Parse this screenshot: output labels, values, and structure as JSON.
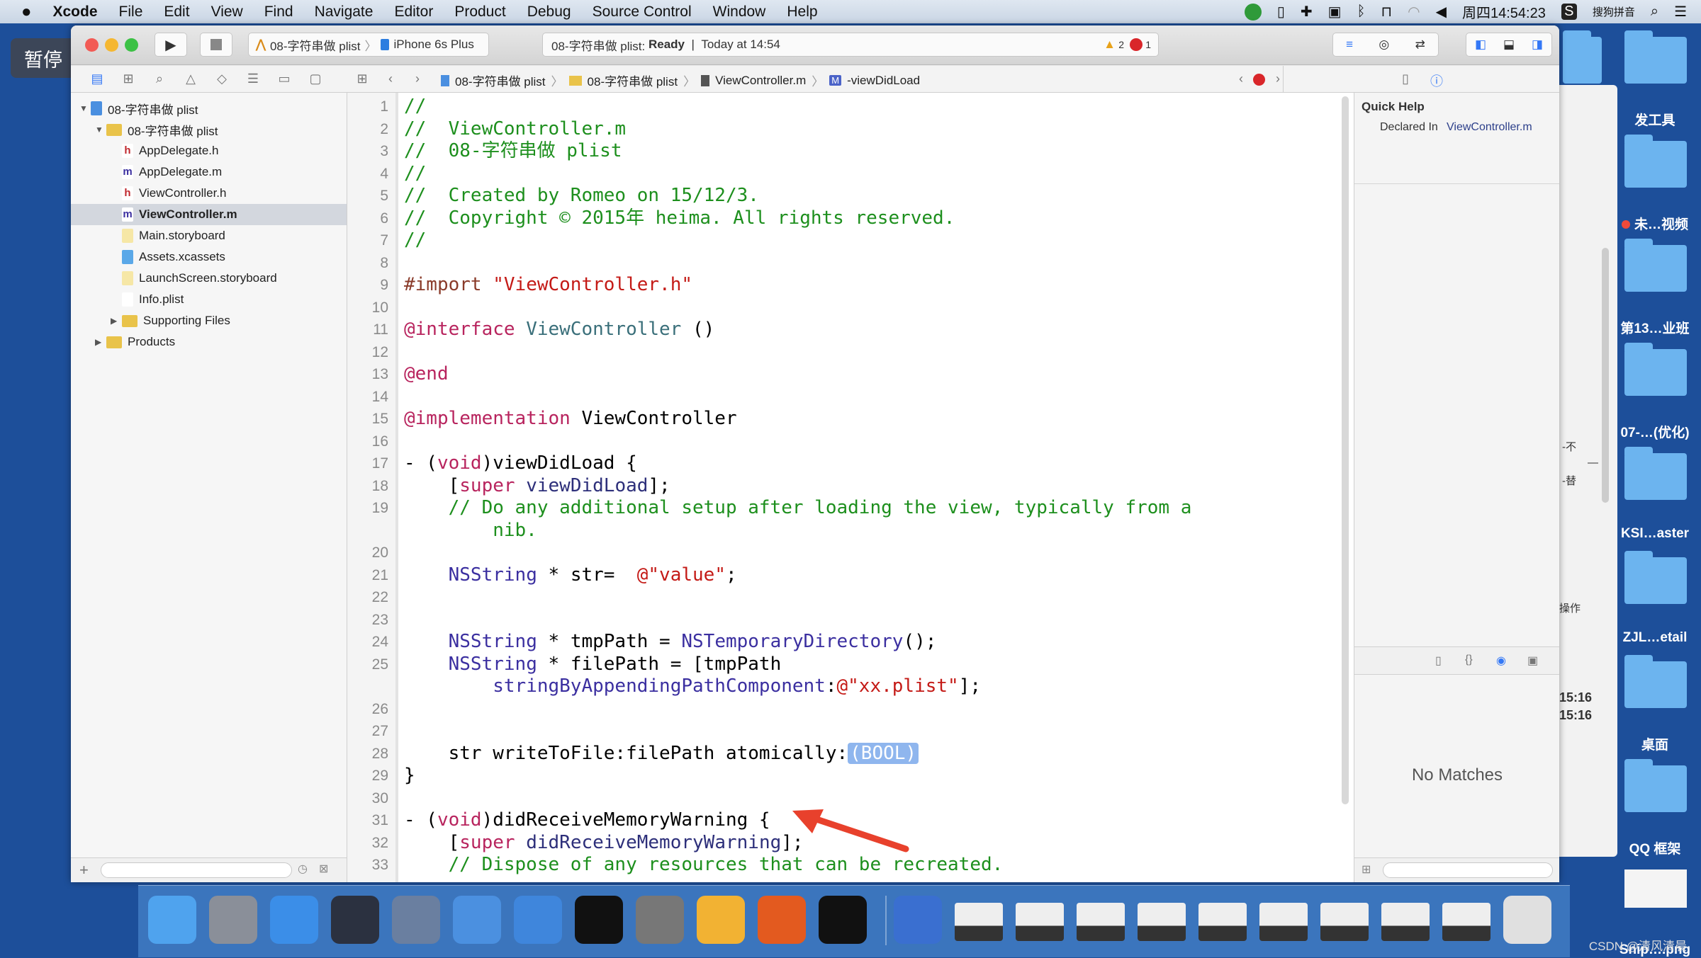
{
  "menubar": {
    "app": "Xcode",
    "items": [
      "File",
      "Edit",
      "View",
      "Find",
      "Navigate",
      "Editor",
      "Product",
      "Debug",
      "Source Control",
      "Window",
      "Help"
    ],
    "clock": "周四14:54:23",
    "ime": "搜狗拼音"
  },
  "overlay_badge": "暂停",
  "toolbar": {
    "scheme_project": "08-字符串做 plist",
    "scheme_device": "iPhone 6s Plus",
    "status_project": "08-字符串做 plist:",
    "status_state": "Ready",
    "status_sep": "|",
    "status_time": "Today at 14:54",
    "warnings": "2",
    "errors": "1"
  },
  "jumpbar": {
    "crumbs": [
      "08-字符串做 plist",
      "08-字符串做 plist",
      "ViewController.m",
      "-viewDidLoad"
    ],
    "method_badge": "M"
  },
  "navigator": {
    "items": [
      {
        "label": "08-字符串做 plist",
        "depth": 0,
        "kind": "project",
        "disclosure": "open"
      },
      {
        "label": "08-字符串做 plist",
        "depth": 1,
        "kind": "folder",
        "disclosure": "open"
      },
      {
        "label": "AppDelegate.h",
        "depth": 2,
        "kind": "h"
      },
      {
        "label": "AppDelegate.m",
        "depth": 2,
        "kind": "m"
      },
      {
        "label": "ViewController.h",
        "depth": 2,
        "kind": "h"
      },
      {
        "label": "ViewController.m",
        "depth": 2,
        "kind": "m",
        "selected": true
      },
      {
        "label": "Main.storyboard",
        "depth": 2,
        "kind": "storyboard"
      },
      {
        "label": "Assets.xcassets",
        "depth": 2,
        "kind": "assets"
      },
      {
        "label": "LaunchScreen.storyboard",
        "depth": 2,
        "kind": "storyboard"
      },
      {
        "label": "Info.plist",
        "depth": 2,
        "kind": "plist"
      },
      {
        "label": "Supporting Files",
        "depth": 2,
        "kind": "folder",
        "disclosure": "closed"
      },
      {
        "label": "Products",
        "depth": 1,
        "kind": "folder",
        "disclosure": "closed"
      }
    ]
  },
  "editor": {
    "rows": [
      {
        "n": "1",
        "s": [
          [
            "com",
            "//"
          ]
        ]
      },
      {
        "n": "2",
        "s": [
          [
            "com",
            "//  ViewController.m"
          ]
        ]
      },
      {
        "n": "3",
        "s": [
          [
            "com",
            "//  08-字符串做 plist"
          ]
        ]
      },
      {
        "n": "4",
        "s": [
          [
            "com",
            "//"
          ]
        ]
      },
      {
        "n": "5",
        "s": [
          [
            "com",
            "//  Created by Romeo on 15/12/3."
          ]
        ]
      },
      {
        "n": "6",
        "s": [
          [
            "com",
            "//  Copyright © 2015年 heima. All rights reserved."
          ]
        ]
      },
      {
        "n": "7",
        "s": [
          [
            "com",
            "//"
          ]
        ]
      },
      {
        "n": "8",
        "s": []
      },
      {
        "n": "9",
        "s": [
          [
            "pre",
            "#import "
          ],
          [
            "str",
            "\"ViewController.h\""
          ]
        ]
      },
      {
        "n": "10",
        "s": []
      },
      {
        "n": "11",
        "s": [
          [
            "kw",
            "@interface "
          ],
          [
            "cls",
            "ViewController"
          ],
          [
            "plain",
            " ()"
          ]
        ]
      },
      {
        "n": "12",
        "s": []
      },
      {
        "n": "13",
        "s": [
          [
            "kw",
            "@end"
          ]
        ]
      },
      {
        "n": "14",
        "s": []
      },
      {
        "n": "15",
        "s": [
          [
            "kw",
            "@implementation "
          ],
          [
            "plain",
            "ViewController"
          ]
        ]
      },
      {
        "n": "16",
        "s": []
      },
      {
        "n": "17",
        "s": [
          [
            "plain",
            "- ("
          ],
          [
            "kw",
            "void"
          ],
          [
            "plain",
            ")viewDidLoad {"
          ]
        ]
      },
      {
        "n": "18",
        "s": [
          [
            "plain",
            "    ["
          ],
          [
            "kw",
            "super"
          ],
          [
            "plain",
            " "
          ],
          [
            "meth",
            "viewDidLoad"
          ],
          [
            "plain",
            "];"
          ]
        ]
      },
      {
        "n": "19",
        "s": [
          [
            "com",
            "    // Do any additional setup after loading the view, typically from a"
          ]
        ]
      },
      {
        "n": "",
        "s": [
          [
            "com",
            "        nib."
          ]
        ]
      },
      {
        "n": "20",
        "s": []
      },
      {
        "n": "21",
        "s": [
          [
            "plain",
            "    "
          ],
          [
            "type",
            "NSString"
          ],
          [
            "plain",
            " * str=  "
          ],
          [
            "str",
            "@\"value\""
          ],
          [
            "plain",
            ";"
          ]
        ]
      },
      {
        "n": "22",
        "s": []
      },
      {
        "n": "23",
        "s": []
      },
      {
        "n": "24",
        "s": [
          [
            "plain",
            "    "
          ],
          [
            "type",
            "NSString"
          ],
          [
            "plain",
            " * tmpPath = "
          ],
          [
            "type",
            "NSTemporaryDirectory"
          ],
          [
            "plain",
            "();"
          ]
        ]
      },
      {
        "n": "25",
        "s": [
          [
            "plain",
            "    "
          ],
          [
            "type",
            "NSString"
          ],
          [
            "plain",
            " * filePath = [tmpPath"
          ]
        ]
      },
      {
        "n": "",
        "s": [
          [
            "plain",
            "        "
          ],
          [
            "type",
            "stringByAppendingPathComponent"
          ],
          [
            "plain",
            ":"
          ],
          [
            "str",
            "@\"xx.plist\""
          ],
          [
            "plain",
            "];"
          ]
        ]
      },
      {
        "n": "26",
        "s": []
      },
      {
        "n": "27",
        "s": []
      },
      {
        "n": "28",
        "s": [
          [
            "plain",
            "    str writeToFile:filePath atomically:"
          ],
          [
            "ph",
            "(BOOL)"
          ]
        ]
      },
      {
        "n": "29",
        "s": [
          [
            "plain",
            "}"
          ]
        ]
      },
      {
        "n": "30",
        "s": []
      },
      {
        "n": "31",
        "s": [
          [
            "plain",
            "- ("
          ],
          [
            "kw",
            "void"
          ],
          [
            "plain",
            ")didReceiveMemoryWarning {"
          ]
        ]
      },
      {
        "n": "32",
        "s": [
          [
            "plain",
            "    ["
          ],
          [
            "kw",
            "super"
          ],
          [
            "plain",
            " "
          ],
          [
            "meth",
            "didReceiveMemoryWarning"
          ],
          [
            "plain",
            "];"
          ]
        ]
      },
      {
        "n": "33",
        "s": [
          [
            "com",
            "    // Dispose of any resources that can be recreated."
          ]
        ]
      }
    ]
  },
  "inspector": {
    "title": "Quick Help",
    "declared_label": "Declared In",
    "declared_value": "ViewController.m",
    "library_empty": "No Matches"
  },
  "background_window": {
    "fragments": [
      "-不",
      "—",
      "-替",
      "操作",
      "15:16",
      "15:16"
    ]
  },
  "desktop": {
    "items": [
      {
        "label": "发工具",
        "tag": ""
      },
      {
        "label": "未…视频",
        "tag": "red"
      },
      {
        "label": "第13…业班"
      },
      {
        "label": "07-…(优化)"
      },
      {
        "label": "KSI…aster"
      },
      {
        "label": "ZJL…etail"
      },
      {
        "label": "桌面"
      },
      {
        "label": "QQ 框架"
      },
      {
        "label": "Snip….png"
      }
    ]
  },
  "dock": {
    "apps": [
      "Finder",
      "Launchpad",
      "Safari",
      "Mouse",
      "Photo Slideshow",
      "Xcode",
      "Simulator",
      "Terminal",
      "System Preferences",
      "Sketch",
      "WPS",
      "Console",
      "QuickTime",
      "Window 1",
      "Window 2",
      "Window 3",
      "Window 4",
      "Window 5",
      "Window 6",
      "Window 7",
      "Window 8",
      "Window 9",
      "Trash"
    ]
  },
  "watermark": "CSDN @清风清晨",
  "colors": {
    "accent": "#3478f6",
    "comment": "#1d8f1d",
    "keyword": "#b8245e",
    "string": "#c41a16",
    "arrow": "#e8412c",
    "selection": "#8fb6ee"
  }
}
